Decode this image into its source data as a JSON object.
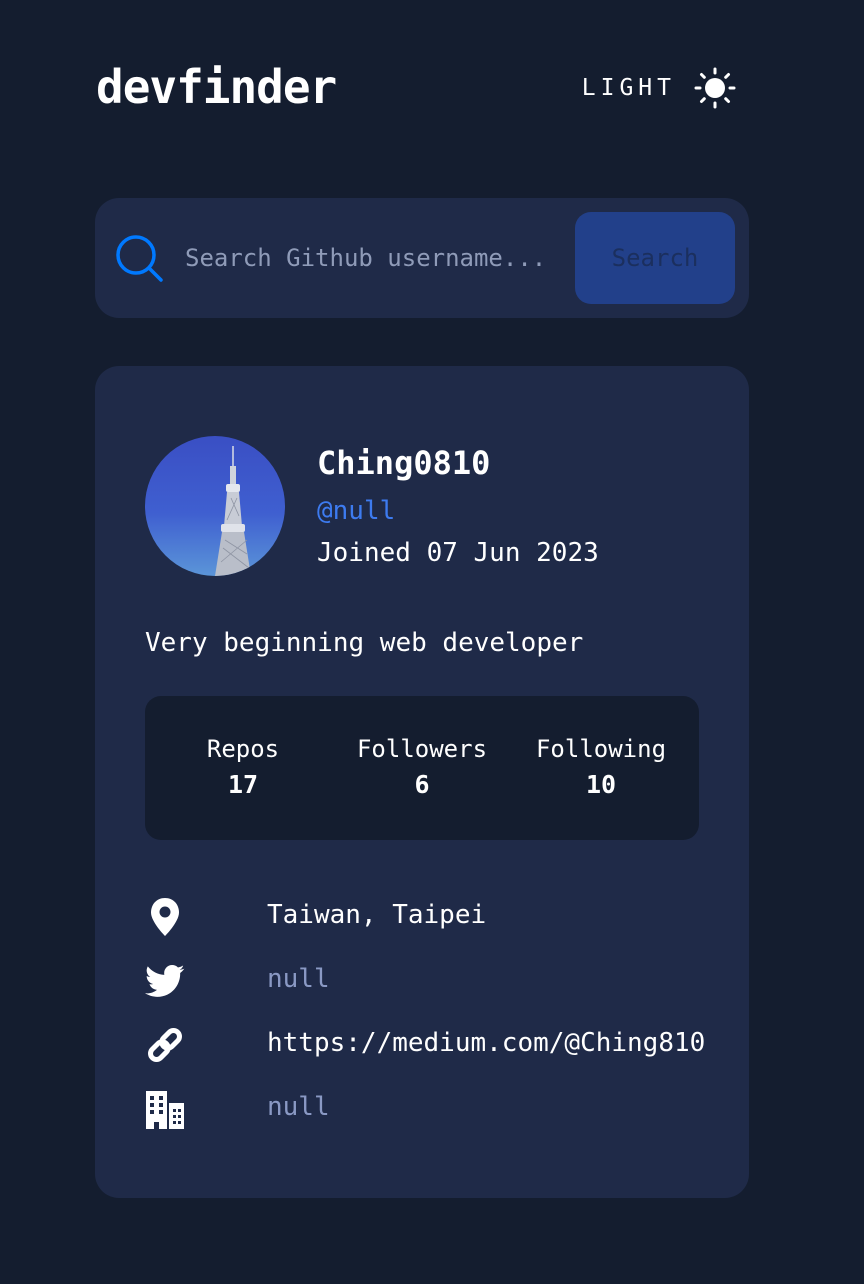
{
  "header": {
    "logo": "devfinder",
    "theme_label": "LIGHT",
    "theme_icon": "sun-icon"
  },
  "search": {
    "placeholder": "Search Github username...",
    "value": "",
    "button_label": "Search",
    "icon": "search-icon"
  },
  "profile": {
    "name": "Ching0810",
    "handle": "@null",
    "joined": "Joined 07 Jun 2023",
    "bio": "Very beginning web developer",
    "avatar": "tokyo-skytree-avatar"
  },
  "stats": [
    {
      "label": "Repos",
      "value": "17"
    },
    {
      "label": "Followers",
      "value": "6"
    },
    {
      "label": "Following",
      "value": "10"
    }
  ],
  "info": {
    "location": {
      "icon": "location-pin-icon",
      "text": "Taiwan, Taipei"
    },
    "twitter": {
      "icon": "twitter-icon",
      "text": "null"
    },
    "website": {
      "icon": "link-icon",
      "text": "https://medium.com/@Ching810"
    },
    "company": {
      "icon": "building-icon",
      "text": "null"
    }
  },
  "colors": {
    "background": "#141d2f",
    "card": "#1f2a48",
    "accent": "#0079ff",
    "link_handle": "#3d7bf0",
    "muted_text": "#8a99c4",
    "text": "#ffffff"
  }
}
